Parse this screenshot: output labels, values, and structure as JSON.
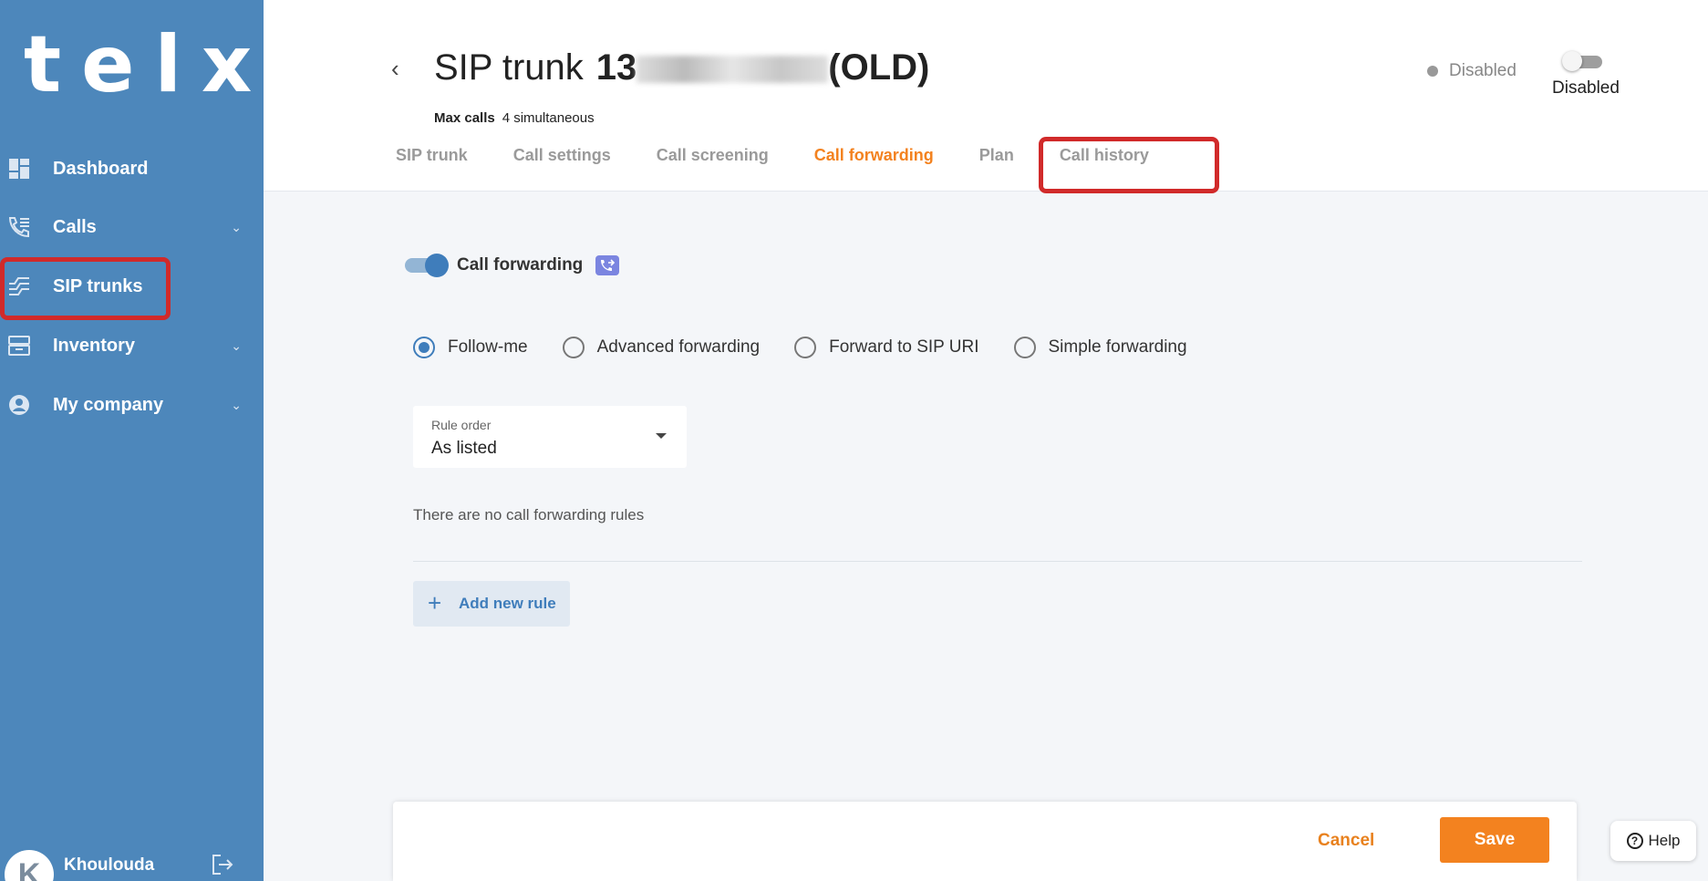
{
  "sidebar": {
    "logo": "telxi",
    "items": [
      {
        "label": "Dashboard",
        "icon": "dashboard-icon"
      },
      {
        "label": "Calls",
        "icon": "calls-icon"
      },
      {
        "label": "SIP trunks",
        "icon": "sip-trunks-icon"
      },
      {
        "label": "Inventory",
        "icon": "inventory-icon"
      },
      {
        "label": "My company",
        "icon": "company-icon"
      }
    ],
    "user": {
      "initial": "K",
      "name": "Khoulouda"
    }
  },
  "header": {
    "title_prefix": "SIP trunk",
    "title_number": "13",
    "title_suffix": "(OLD)",
    "max_calls_label": "Max calls",
    "max_calls_value": "4 simultaneous",
    "status_text": "Disabled",
    "toggle_label": "Disabled"
  },
  "tabs": [
    {
      "label": "SIP trunk"
    },
    {
      "label": "Call settings"
    },
    {
      "label": "Call screening"
    },
    {
      "label": "Call forwarding"
    },
    {
      "label": "Plan"
    },
    {
      "label": "Call history"
    }
  ],
  "content": {
    "call_forwarding_label": "Call forwarding",
    "radios": [
      {
        "label": "Follow-me"
      },
      {
        "label": "Advanced forwarding"
      },
      {
        "label": "Forward to SIP URI"
      },
      {
        "label": "Simple forwarding"
      }
    ],
    "rule_order_label": "Rule order",
    "rule_order_value": "As listed",
    "no_rules_text": "There are no call forwarding rules",
    "add_rule_label": "Add new rule"
  },
  "footer": {
    "cancel_label": "Cancel",
    "save_label": "Save"
  },
  "help_label": "Help",
  "colors": {
    "sidebar": "#4d87bb",
    "accent": "#f3821f",
    "primary": "#3f7dbb",
    "highlight": "#d12a2a"
  }
}
